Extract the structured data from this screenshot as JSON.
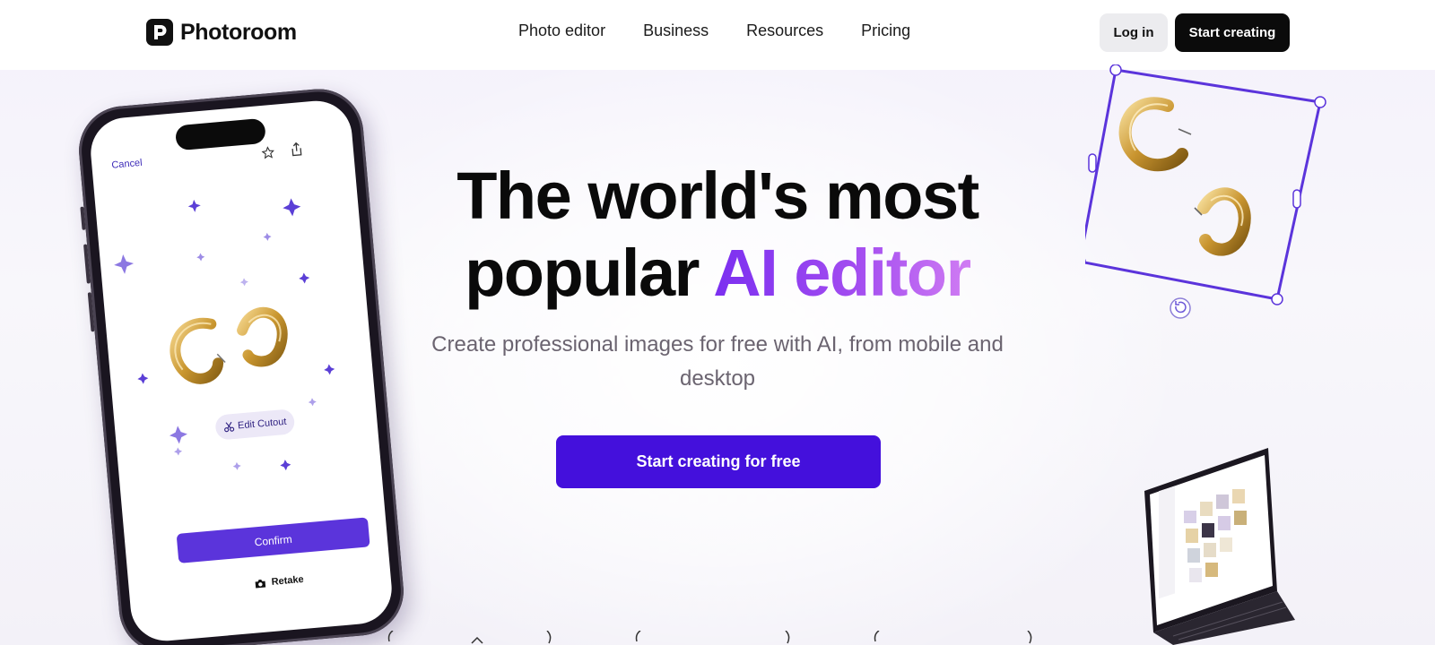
{
  "header": {
    "logo_text": "Photoroom",
    "nav": [
      {
        "label": "Photo editor"
      },
      {
        "label": "Business"
      },
      {
        "label": "Resources"
      },
      {
        "label": "Pricing"
      }
    ],
    "login_label": "Log in",
    "start_label": "Start creating"
  },
  "hero": {
    "title_line1": "The world's most",
    "title_line2_plain": "popular ",
    "title_line2_accent": "AI editor",
    "subtitle": "Create professional images for free with AI, from mobile and desktop",
    "cta_label": "Start creating for free"
  },
  "phone": {
    "cancel_label": "Cancel",
    "edit_cutout_label": "Edit Cutout",
    "confirm_label": "Confirm",
    "retake_label": "Retake"
  },
  "colors": {
    "accent": "#4410dc",
    "gradient_start": "#7b2ff0",
    "gradient_end": "#d07cf3",
    "selection": "#5b34db"
  },
  "icons": [
    "logo-icon",
    "star-icon",
    "share-icon",
    "scissors-icon",
    "camera-icon",
    "rotate-icon"
  ]
}
